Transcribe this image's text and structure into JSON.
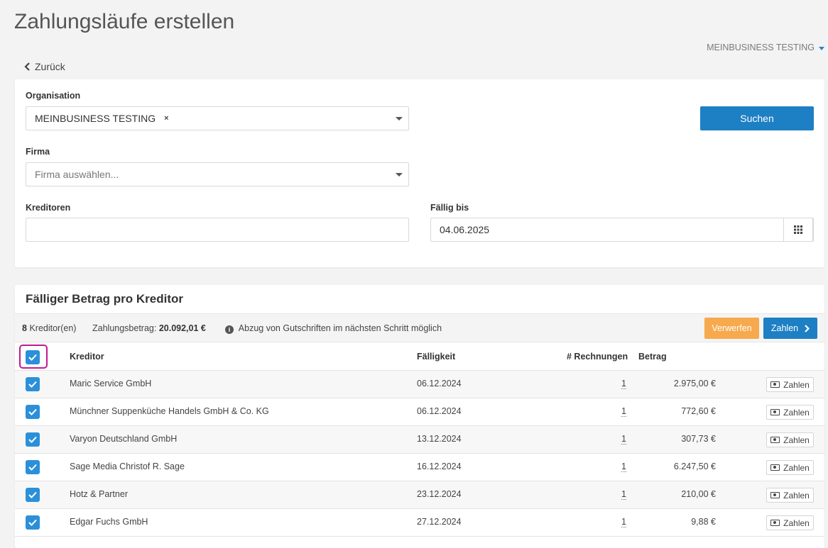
{
  "header": {
    "title": "Zahlungsläufe erstellen",
    "org_switch": "MEINBUSINESS TESTING",
    "back_label": "Zurück"
  },
  "filters": {
    "organisation_label": "Organisation",
    "organisation_value": "MEINBUSINESS TESTING",
    "organisation_remove": "×",
    "search_label": "Suchen",
    "firma_label": "Firma",
    "firma_placeholder": "Firma auswählen...",
    "kreditoren_label": "Kreditoren",
    "kreditoren_value": "",
    "faellig_label": "Fällig bis",
    "faellig_value": "04.06.2025"
  },
  "table": {
    "title": "Fälliger Betrag pro Kreditor",
    "summary_count": "8",
    "summary_count_unit": "Kreditor(en)",
    "summary_amount_label": "Zahlungsbetrag:",
    "summary_amount_value": "20.092,01 €",
    "summary_info": "Abzug von Gutschriften im nächsten Schritt möglich",
    "discard_label": "Verwerfen",
    "pay_label": "Zahlen",
    "columns": {
      "kreditor": "Kreditor",
      "faelligkeit": "Fälligkeit",
      "rechnungen": "# Rechnungen",
      "betrag": "Betrag"
    },
    "row_action_label": "Zahlen",
    "rows": [
      {
        "kreditor": "Maric Service GmbH",
        "faelligkeit": "06.12.2024",
        "rechnungen": "1",
        "betrag": "2.975,00 €"
      },
      {
        "kreditor": "Münchner Suppenküche Handels GmbH & Co. KG",
        "faelligkeit": "06.12.2024",
        "rechnungen": "1",
        "betrag": "772,60 €"
      },
      {
        "kreditor": "Varyon Deutschland GmbH",
        "faelligkeit": "13.12.2024",
        "rechnungen": "1",
        "betrag": "307,73 €"
      },
      {
        "kreditor": "Sage Media Christof R. Sage",
        "faelligkeit": "16.12.2024",
        "rechnungen": "1",
        "betrag": "6.247,50 €"
      },
      {
        "kreditor": "Hotz & Partner",
        "faelligkeit": "23.12.2024",
        "rechnungen": "1",
        "betrag": "210,00 €"
      },
      {
        "kreditor": "Edgar Fuchs GmbH",
        "faelligkeit": "27.12.2024",
        "rechnungen": "1",
        "betrag": "9,88 €"
      }
    ]
  }
}
